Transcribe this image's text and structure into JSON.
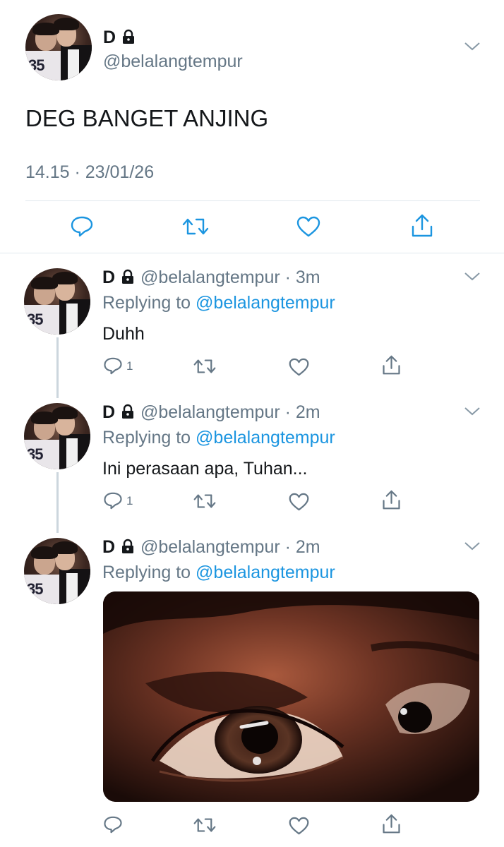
{
  "main_tweet": {
    "display_name": "D",
    "handle": "@belalangtempur",
    "text": "DEG BANGET ANJING",
    "timestamp": "14.15 · 23/01/26"
  },
  "replies": [
    {
      "display_name": "D",
      "handle": "@belalangtempur",
      "time": "3m",
      "replying_prefix": "Replying to",
      "replying_to": "@belalangtempur",
      "text": "Duhh",
      "reply_count": "1"
    },
    {
      "display_name": "D",
      "handle": "@belalangtempur",
      "time": "2m",
      "replying_prefix": "Replying to",
      "replying_to": "@belalangtempur",
      "text": "Ini perasaan apa, Tuhan...",
      "reply_count": "1"
    },
    {
      "display_name": "D",
      "handle": "@belalangtempur",
      "time": "2m",
      "replying_prefix": "Replying to",
      "replying_to": "@belalangtempur",
      "media": "photo of close-up teary eyes"
    }
  ],
  "separator": "·",
  "avatar_text": "35",
  "colors": {
    "text": "#14171a",
    "secondary": "#657786",
    "link": "#1b95e0",
    "divider": "#e1e8ed"
  },
  "icons": [
    "lock-icon",
    "chevron-down-icon",
    "reply-icon",
    "retweet-icon",
    "like-icon",
    "share-icon"
  ]
}
